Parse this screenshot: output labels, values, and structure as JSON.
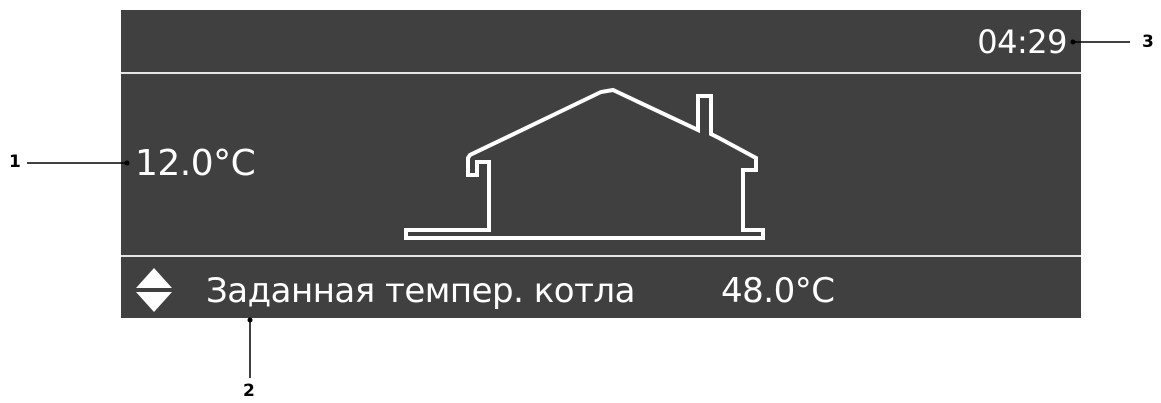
{
  "screen": {
    "background": "#404040",
    "foreground": "#ffffff",
    "clock": "04:29",
    "outdoor_temperature": "12.0°C",
    "house_icon": "house-outline-icon",
    "adjust_icon": "up-down-arrows-icon",
    "parameter": {
      "label": "Заданная темпер. котла",
      "value": "48.0°C"
    }
  },
  "callouts": {
    "c1": "1",
    "c2": "2",
    "c3": "3"
  }
}
